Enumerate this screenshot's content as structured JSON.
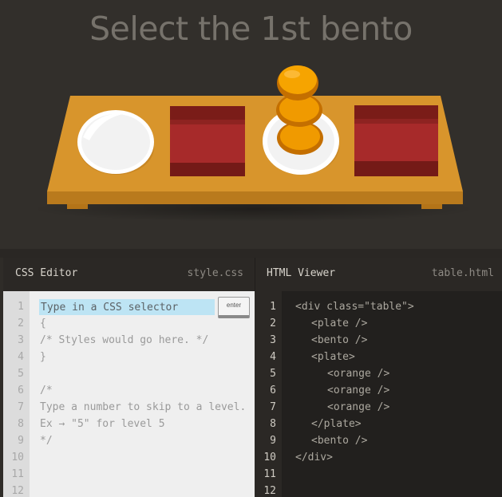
{
  "game": {
    "title": "Select the 1st bento"
  },
  "css_editor": {
    "header_title": "CSS Editor",
    "filename": "style.css",
    "input_placeholder": "Type in a CSS selector",
    "enter_label": "enter",
    "line_numbers": [
      "1",
      "2",
      "3",
      "4",
      "5",
      "6",
      "7",
      "8",
      "9",
      "10",
      "11",
      "12"
    ],
    "code_lines": [
      "{",
      "/* Styles would go here. */",
      "}",
      "",
      "/*",
      "Type a number to skip to a level.",
      "Ex → \"5\" for level 5",
      "*/"
    ]
  },
  "html_viewer": {
    "header_title": "HTML Viewer",
    "filename": "table.html",
    "line_numbers": [
      "1",
      "2",
      "3",
      "4",
      "5",
      "6",
      "7",
      "8",
      "9",
      "10",
      "11",
      "12"
    ],
    "code_lines": [
      "<div class=\"table\">",
      "<plate />",
      "<bento />",
      "<plate>",
      "<orange />",
      "<orange />",
      "<orange />",
      "</plate>",
      "<bento />",
      "</div>"
    ]
  },
  "colors": {
    "table": "#d8952c",
    "plate": "#ffffff",
    "bento": "#a72a2a",
    "orange": "#f29a00",
    "selector_highlight": "#bde4f4"
  }
}
